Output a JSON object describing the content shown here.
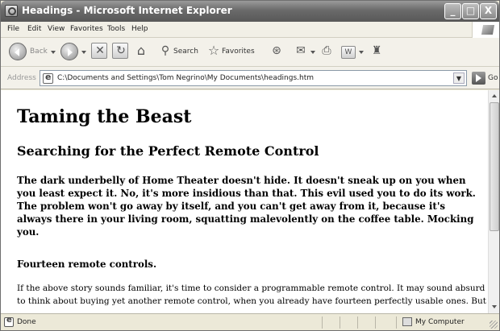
{
  "window": {
    "title": "Headings - Microsoft Internet Explorer",
    "controls": {
      "minimize": "_",
      "maximize": "□",
      "close": "X"
    }
  },
  "menu": [
    "File",
    "Edit",
    "View",
    "Favorites",
    "Tools",
    "Help"
  ],
  "toolbar": {
    "back_label": "Back",
    "search_label": "Search",
    "favorites_label": "Favorites"
  },
  "address": {
    "label": "Address",
    "value": "C:\\Documents and Settings\\Tom Negrino\\My Documents\\headings.htm",
    "go_label": "Go"
  },
  "page": {
    "h1": "Taming the Beast",
    "h2": "Searching for the Perfect Remote Control",
    "h4_intro": "The dark underbelly of Home Theater doesn't hide. It doesn't sneak up on you when you least expect it. No, it's more insidious than that. This evil used you to do its work. The problem won't go away by itself, and you can't get away from it, because it's always there in your living room, squatting malevolently on the coffee table. Mocking you.",
    "h4_second": "Fourteen remote controls.",
    "paragraph": "If the above story sounds familiar, it's time to consider a programmable remote control. It may sound absurd to think about buying yet another remote control, when you already have fourteen perfectly usable ones. But"
  },
  "status": {
    "text": "Done",
    "zone": "My Computer"
  },
  "icons": {
    "app": "ie-page-icon",
    "back": "back-arrow-icon",
    "forward": "forward-arrow-icon",
    "stop": "stop-icon",
    "refresh": "refresh-icon",
    "home": "home-icon",
    "search": "search-icon",
    "favorites": "favorites-star-icon",
    "history": "history-icon",
    "mail": "mail-icon",
    "print": "print-icon",
    "edit": "edit-icon",
    "messenger": "messenger-icon",
    "go": "go-arrow-icon"
  }
}
